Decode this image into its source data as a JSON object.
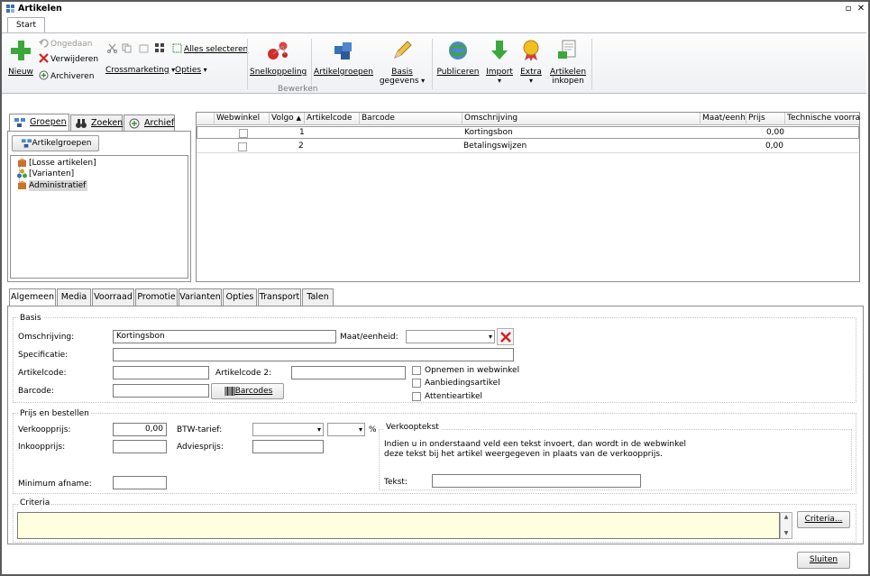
{
  "window": {
    "title": "Artikelen",
    "restore_glyph": "▫",
    "close_glyph": "✕"
  },
  "ribbon": {
    "tab": "Start",
    "nieuw": "Nieuw",
    "ongedaan": "Ongedaan",
    "verwijderen": "Verwijderen",
    "archiveren": "Archiveren",
    "alles_selecteren": "Alles selecteren",
    "crossmarketing": "Crossmarketing",
    "opties": "Opties",
    "snelkoppeling": "Snelkoppeling",
    "artikelgroepen": "Artikelgroepen",
    "basis_gegevens_1": "Basis",
    "basis_gegevens_2": "gegevens",
    "publiceren": "Publiceren",
    "import": "Import",
    "extra": "Extra",
    "artikelen_inkopen_1": "Artikelen",
    "artikelen_inkopen_2": "inkopen",
    "group_label": "Bewerken"
  },
  "left_tabs": [
    "Groepen",
    "Zoeken",
    "Archief"
  ],
  "left": {
    "artikelgroepen_button": "Artikelgroepen",
    "tree": [
      "[Losse artikelen]",
      "[Varianten]",
      "Administratief"
    ]
  },
  "grid": {
    "columns": [
      "Webwinkel",
      "Volgo",
      "Artikelcode",
      "Barcode",
      "Omschrijving",
      "Maat/eenhe",
      "Prijs",
      "Technische voorraad"
    ],
    "sort_glyph": "▲",
    "rows": [
      {
        "volgorde": "1",
        "omschrijving": "Kortingsbon",
        "prijs": "0,00"
      },
      {
        "volgorde": "2",
        "omschrijving": "Betalingswijzen",
        "prijs": "0,00"
      }
    ]
  },
  "bottom_tabs": [
    "Algemeen",
    "Media",
    "Voorraad",
    "Promotie",
    "Varianten",
    "Opties",
    "Transport",
    "Talen"
  ],
  "basis": {
    "title": "Basis",
    "omschrijving_label": "Omschrijving:",
    "omschrijving_value": "Kortingsbon",
    "maat_label": "Maat/eenheid:",
    "specificatie_label": "Specificatie:",
    "artikelcode_label": "Artikelcode:",
    "artikelcode2_label": "Artikelcode 2:",
    "barcode_label": "Barcode:",
    "barcodes_button": "Barcodes",
    "opnemen_label": "Opnemen in webwinkel",
    "aanbieding_label": "Aanbiedingsartikel",
    "attentie_label": "Attentieartikel"
  },
  "prijs": {
    "title": "Prijs en bestellen",
    "verkoopprijs_label": "Verkoopprijs:",
    "verkoopprijs_value": "0,00",
    "inkoopprijs_label": "Inkoopprijs:",
    "btw_label": "BTW-tarief:",
    "advies_label": "Adviesprijs:",
    "minimum_label": "Minimum afname:",
    "percent": "%",
    "verkooptekst_title": "Verkooptekst",
    "verkooptekst_info_1": "Indien u in onderstaand veld een tekst invoert, dan wordt in de webwinkel",
    "verkooptekst_info_2": "deze tekst bij het artikel weergegeven in plaats van de verkoopprijs.",
    "tekst_label": "Tekst:"
  },
  "criteria": {
    "title": "Criteria",
    "button": "Criteria...",
    "up": "▲",
    "down": "▼"
  },
  "sluiten": "Sluiten",
  "colors": {
    "accent": "#3a6fb5",
    "criteria_bg": "#ffffe0",
    "delete_red": "#d42020"
  }
}
